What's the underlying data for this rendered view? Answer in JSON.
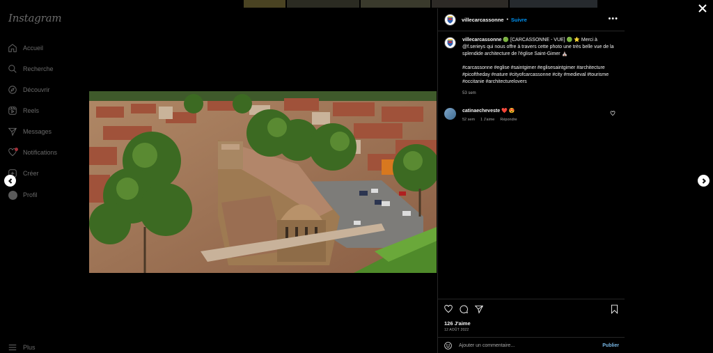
{
  "app": {
    "logo": "Instagram"
  },
  "sidebar": {
    "items": [
      {
        "label": "Accueil",
        "icon": "home-icon"
      },
      {
        "label": "Recherche",
        "icon": "search-icon"
      },
      {
        "label": "Découvrir",
        "icon": "compass-icon"
      },
      {
        "label": "Reels",
        "icon": "reels-icon"
      },
      {
        "label": "Messages",
        "icon": "send-icon"
      },
      {
        "label": "Notifications",
        "icon": "heart-icon"
      },
      {
        "label": "Créer",
        "icon": "plus-square-icon"
      },
      {
        "label": "Profil",
        "icon": "avatar"
      }
    ],
    "more_label": "Plus"
  },
  "post": {
    "username": "villecarcassonne",
    "follow_label": "Suivre",
    "caption": {
      "username": "villecarcassonne",
      "text": "🟢 [CARCASSONNE - VUE] 🟢 ⭐ Merci à @f.serieys qui nous offre à travers cette photo une très belle vue de la splendide architecture de l'église Saint-Gimer ⛪",
      "hashtags": "#carcassonne #eglise #saintgimer #eglisesaintgimer #architecture #picoftheday #nature #cityofcarcassonne #city #medieval #tourisme #occitanie #architecturelovers",
      "age": "53 sem"
    },
    "comments": [
      {
        "username": "catinaecheveste",
        "text": "❤️ 😍",
        "age": "52 sem",
        "likes": "1 J'aime",
        "reply_label": "Répondre"
      }
    ],
    "likes": "126 J'aime",
    "date": "12 AOÛT 2022",
    "add_comment_placeholder": "Ajouter un commentaire...",
    "publish_label": "Publier"
  },
  "colors": {
    "background": "#000000",
    "accent_link": "#0095f6",
    "muted_text": "#a8a8a8",
    "divider": "#262626"
  }
}
